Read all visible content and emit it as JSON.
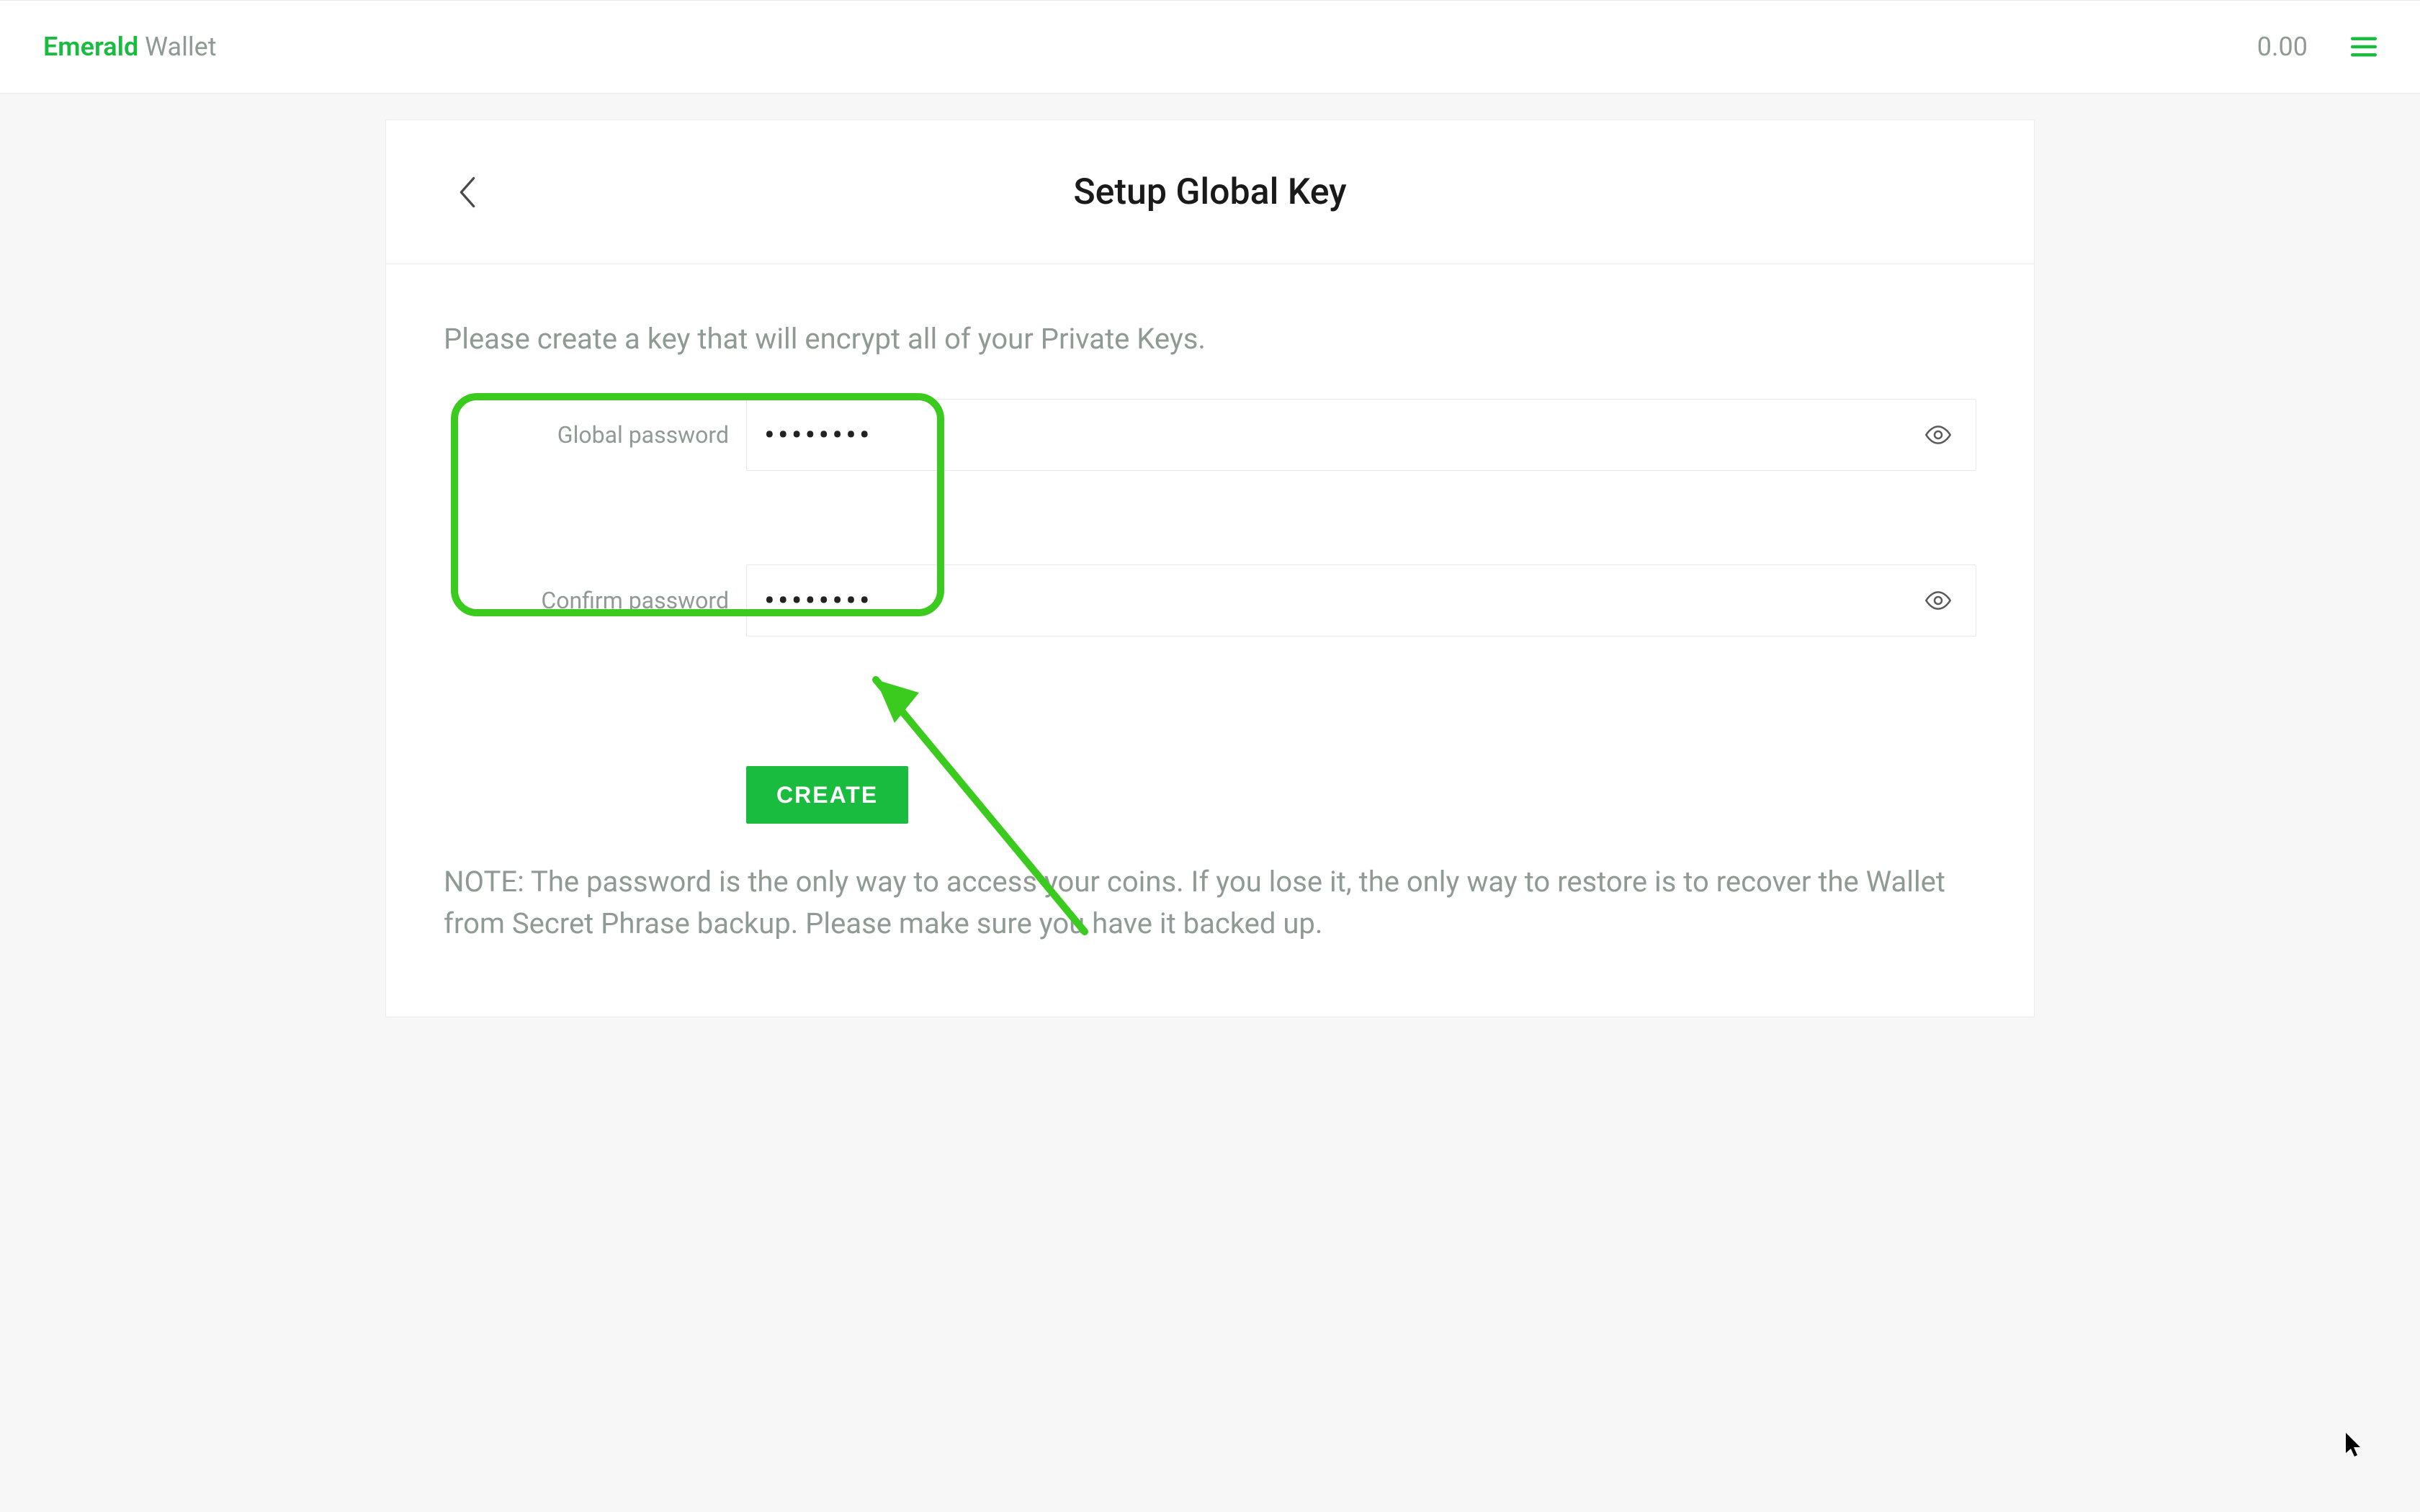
{
  "header": {
    "brand_a": "Emerald",
    "brand_b": " Wallet",
    "balance": "0.00"
  },
  "card": {
    "title": "Setup Global Key",
    "intro": "Please create a key that will encrypt all of your Private Keys.",
    "password_label": "Global password",
    "confirm_label": "Confirm password",
    "password_value": "••••••••",
    "confirm_value": "••••••••",
    "create_label": "CREATE",
    "note": "NOTE: The password is the only way to access your coins. If you lose it, the only way to restore is to recover the Wallet from Secret Phrase backup. Please make sure you have it backed up."
  }
}
